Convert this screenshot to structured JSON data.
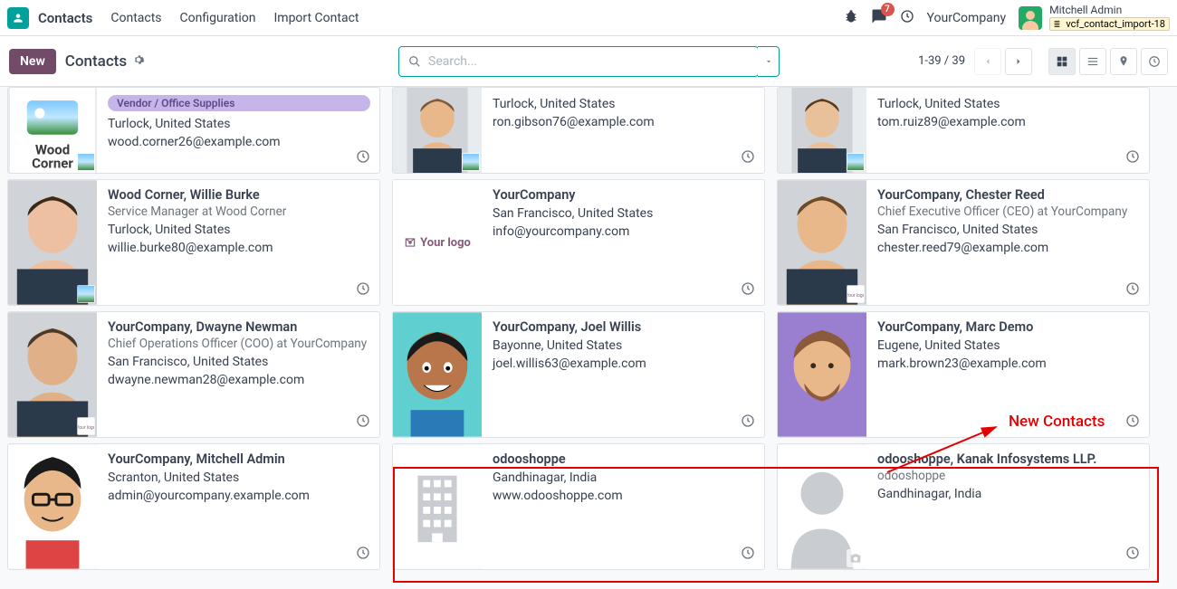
{
  "app": {
    "name": "Contacts"
  },
  "nav": {
    "items": [
      "Contacts",
      "Configuration",
      "Import Contact"
    ]
  },
  "msg_badge": "7",
  "company": "YourCompany",
  "user": {
    "name": "Mitchell Admin",
    "db": "vcf_contact_import-18"
  },
  "ctrl": {
    "new_btn": "New",
    "title": "Contacts",
    "search_placeholder": "Search..."
  },
  "pager": {
    "text": "1-39 / 39"
  },
  "annotation": {
    "label": "New Contacts"
  },
  "cards": [
    [
      {
        "tag": "Vendor / Office Supplies",
        "name": "",
        "sub": "",
        "loc": "Turlock, United States",
        "email": "wood.corner26@example.com",
        "av": "woodcorner",
        "chip": "sky"
      },
      {
        "name": "",
        "sub": "",
        "loc": "Turlock, United States",
        "email": "ron.gibson76@example.com",
        "av": "man1",
        "chip": "sky"
      },
      {
        "name": "",
        "sub": "",
        "loc": "Turlock, United States",
        "email": "tom.ruiz89@example.com",
        "av": "man2",
        "chip": "sky"
      }
    ],
    [
      {
        "name": "Wood Corner, Willie Burke",
        "sub": "Service Manager at Wood Corner",
        "loc": "Turlock, United States",
        "email": "willie.burke80@example.com",
        "av": "man3",
        "chip": "sky"
      },
      {
        "name": "YourCompany",
        "sub": "",
        "loc": "San Francisco, United States",
        "email": "info@yourcompany.com",
        "av": "yourlogo"
      },
      {
        "name": "YourCompany, Chester Reed",
        "sub": "Chief Executive Officer (CEO) at YourCompany",
        "loc": "San Francisco, United States",
        "email": "chester.reed79@example.com",
        "av": "man4",
        "chip": "logo"
      }
    ],
    [
      {
        "name": "YourCompany, Dwayne Newman",
        "sub": "Chief Operations Officer (COO) at YourCompany",
        "loc": "San Francisco, United States",
        "email": "dwayne.newman28@example.com",
        "av": "man5",
        "chip": "logo"
      },
      {
        "name": "YourCompany, Joel Willis",
        "sub": "",
        "loc": "Bayonne, United States",
        "email": "joel.willis63@example.com",
        "av": "cartoon1"
      },
      {
        "name": "YourCompany, Marc Demo",
        "sub": "",
        "loc": "Eugene, United States",
        "email": "mark.brown23@example.com",
        "av": "cartoon2"
      }
    ],
    [
      {
        "name": "YourCompany, Mitchell Admin",
        "sub": "",
        "loc": "Scranton, United States",
        "email": "admin@yourcompany.example.com",
        "av": "cartoon3"
      },
      {
        "name": "odooshoppe",
        "sub": "",
        "loc": "Gandhinagar, India",
        "email": "www.odooshoppe.com",
        "av": "building"
      },
      {
        "name": "odooshoppe, Kanak Infosystems LLP.",
        "sub": "odooshoppe",
        "loc": "Gandhinagar, India",
        "email": "",
        "av": "silhouette",
        "chip_cam": true
      }
    ]
  ]
}
